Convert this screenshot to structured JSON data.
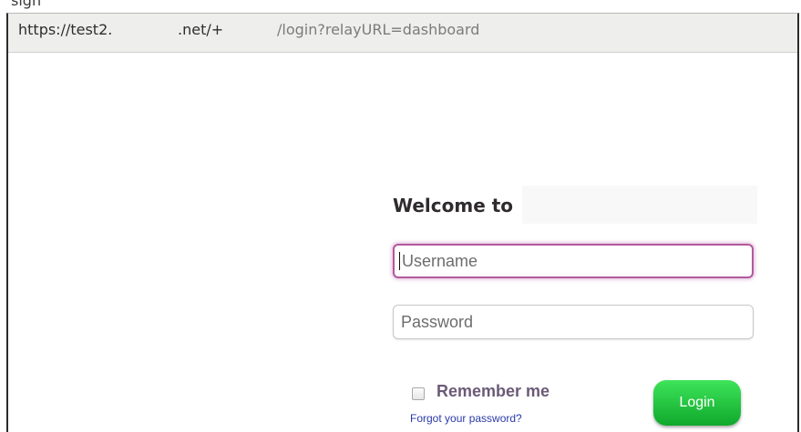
{
  "browser": {
    "address_bar": {
      "url_segments": [
        "https://test2.",
        ".net/+",
        "/login?relayURL=dashboard"
      ]
    },
    "top_fragment": "sign"
  },
  "login_page": {
    "heading": "Welcome to",
    "username_field": {
      "placeholder": "Username",
      "value": "",
      "focused": true
    },
    "password_field": {
      "placeholder": "Password",
      "value": ""
    },
    "remember_me": {
      "label": "Remember me",
      "checked": false
    },
    "forgot_password_link": "Forgot your password?",
    "login_button": "Login"
  },
  "colors": {
    "focus_border": "#b25a9e",
    "login_button": "#22c23e",
    "link": "#2a3aa8",
    "remember_label": "#6b5a77"
  }
}
